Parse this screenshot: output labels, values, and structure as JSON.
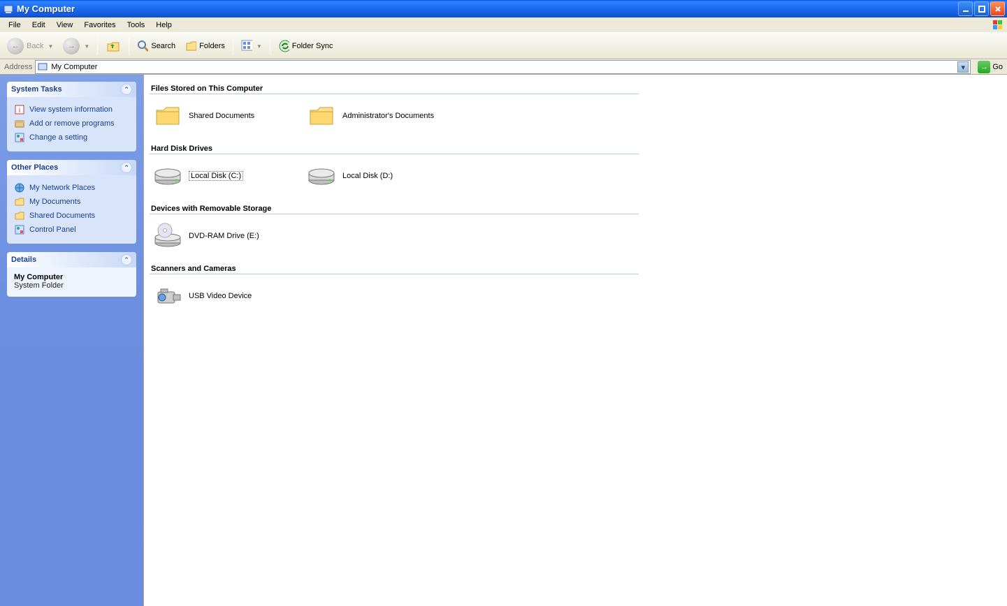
{
  "window": {
    "title": "My Computer"
  },
  "menu": {
    "items": [
      "File",
      "Edit",
      "View",
      "Favorites",
      "Tools",
      "Help"
    ]
  },
  "toolbar": {
    "back": "Back",
    "search": "Search",
    "folders": "Folders",
    "folder_sync": "Folder Sync"
  },
  "address": {
    "label": "Address",
    "value": "My Computer",
    "go": "Go"
  },
  "sidebar": {
    "system_tasks": {
      "title": "System Tasks",
      "links": [
        "View system information",
        "Add or remove programs",
        "Change a setting"
      ]
    },
    "other_places": {
      "title": "Other Places",
      "links": [
        "My Network Places",
        "My Documents",
        "Shared Documents",
        "Control Panel"
      ]
    },
    "details": {
      "title": "Details",
      "name": "My Computer",
      "type": "System Folder"
    }
  },
  "content": {
    "groups": [
      {
        "title": "Files Stored on This Computer",
        "items": [
          {
            "label": "Shared Documents",
            "icon": "folder"
          },
          {
            "label": "Administrator's Documents",
            "icon": "folder"
          }
        ]
      },
      {
        "title": "Hard Disk Drives",
        "items": [
          {
            "label": "Local Disk (C:)",
            "icon": "hdd",
            "selected": true
          },
          {
            "label": "Local Disk (D:)",
            "icon": "hdd"
          }
        ]
      },
      {
        "title": "Devices with Removable Storage",
        "items": [
          {
            "label": "DVD-RAM Drive (E:)",
            "icon": "dvd"
          }
        ]
      },
      {
        "title": "Scanners and Cameras",
        "items": [
          {
            "label": "USB Video Device",
            "icon": "camera"
          }
        ]
      }
    ]
  }
}
